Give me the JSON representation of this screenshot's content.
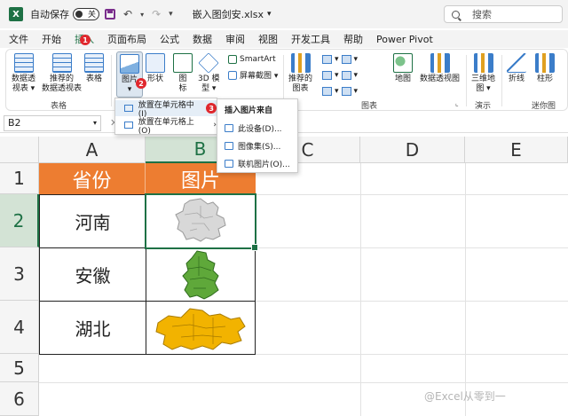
{
  "titlebar": {
    "logo": "X",
    "autosave_label": "自动保存",
    "toggle_state": "关",
    "filename": "嵌入图剑安.xlsx",
    "search_placeholder": "搜索"
  },
  "menu": {
    "tabs": [
      "文件",
      "开始",
      "插入",
      "页面布局",
      "公式",
      "数据",
      "审阅",
      "视图",
      "开发工具",
      "帮助",
      "Power Pivot"
    ],
    "active_index": 2,
    "badge": "1"
  },
  "ribbon": {
    "pivot_table": "数据透\n视表 ▾",
    "recommended_pivot": "推荐的\n数据透视表",
    "table": "表格",
    "group_tables": "表格",
    "pictures": "图片",
    "shapes": "形状",
    "icons": "图\n标",
    "model_3d": "3D 模\n型 ▾",
    "smartart": "SmartArt",
    "screenshot": "屏幕截图 ▾",
    "recommended_charts": "推荐的\n图表",
    "maps": "地图",
    "pivot_chart": "数据透视图",
    "group_charts": "图表",
    "map_3d": "三维地\n图 ▾",
    "group_tours": "演示",
    "line": "折线",
    "column": "柱形",
    "group_sparklines": "迷你图",
    "badge": "2"
  },
  "formula": {
    "namebox": "B2",
    "cancel": "✕",
    "enter": "✓",
    "fx": "fx"
  },
  "grid": {
    "columns": [
      "A",
      "B",
      "C",
      "D",
      "E"
    ],
    "rows": [
      "1",
      "2",
      "3",
      "4",
      "5",
      "6"
    ],
    "header_province": "省份",
    "header_picture": "图片",
    "provinces": [
      "河南",
      "安徽",
      "湖北"
    ],
    "colors": {
      "header_fill": "#ed7d31",
      "henan_map": "#d8d8d8",
      "anhui_map": "#5fa83a",
      "hubei_map": "#f2b300",
      "selection": "#1e7145"
    }
  },
  "menu_picture": {
    "place_in_cell": "放置在单元格中(I)",
    "place_over_cell": "放置在单元格上(O)",
    "badge": "3"
  },
  "menu_insert_from": {
    "header": "插入图片来自",
    "this_device": "此设备(D)...",
    "stock_images": "图像集(S)...",
    "online_pictures": "联机图片(O)..."
  },
  "watermark": "@Excel从零到一"
}
